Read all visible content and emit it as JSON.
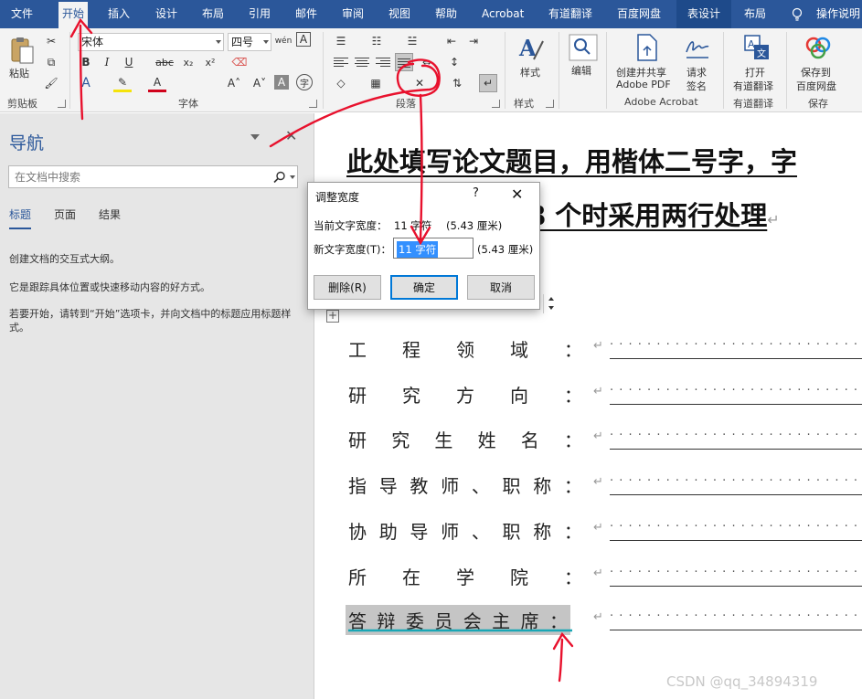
{
  "tabs": [
    "文件",
    "开始",
    "插入",
    "设计",
    "布局",
    "引用",
    "邮件",
    "审阅",
    "视图",
    "帮助",
    "Acrobat",
    "有道翻译",
    "百度网盘",
    "表设计",
    "布局"
  ],
  "tell_me": "操作说明",
  "ribbon": {
    "clipboard": {
      "paste": "粘贴",
      "group": "剪贴板"
    },
    "font": {
      "font_name": "宋体",
      "font_size": "四号",
      "group": "字体"
    },
    "paragraph": {
      "group": "段落"
    },
    "styles": {
      "label": "样式",
      "group": "样式"
    },
    "editing": {
      "label": "编辑"
    },
    "acrobat": {
      "create_share_1": "创建并共享",
      "create_share_2": "Adobe PDF",
      "sign_1": "请求",
      "sign_2": "签名",
      "group": "Adobe Acrobat"
    },
    "youdao": {
      "open_1": "打开",
      "open_2": "有道翻译",
      "group": "有道翻译"
    },
    "baidu": {
      "save_1": "保存到",
      "save_2": "百度网盘",
      "group": "保存"
    }
  },
  "nav": {
    "title": "导航",
    "search_placeholder": "在文档中搜索",
    "tabs": [
      "标题",
      "页面",
      "结果"
    ],
    "p1": "创建文档的交互式大纲。",
    "p2": "它是跟踪具体位置或快速移动内容的好方式。",
    "p3": "若要开始，请转到“开始”选项卡，并向文档中的标题应用标题样式。"
  },
  "doc": {
    "title_line1": "此处填写论文题目，用楷体二号字，字",
    "title_line2": "8 个时采用两行处理",
    "rows": [
      {
        "label": "工程领域：",
        "chars": [
          "工",
          "程",
          "领",
          "域",
          "："
        ]
      },
      {
        "label": "研究方向：",
        "chars": [
          "研",
          "究",
          "方",
          "向",
          "："
        ]
      },
      {
        "label": "研究生姓名：",
        "chars": [
          "研",
          "究",
          "生",
          "姓",
          "名",
          "："
        ]
      },
      {
        "label": "指导教师、职称：",
        "chars": [
          "指",
          "导",
          "教",
          "师",
          "、",
          "职",
          "称",
          "："
        ]
      },
      {
        "label": "协助导师、职称：",
        "chars": [
          "协",
          "助",
          "导",
          "师",
          "、",
          "职",
          "称",
          "："
        ]
      },
      {
        "label": "所在学院：",
        "chars": [
          "所",
          "在",
          "学",
          "院",
          "："
        ]
      },
      {
        "label": "答辩委员会主席：",
        "chars": [
          "答",
          "辩",
          "委",
          "员",
          "会",
          "主",
          "席",
          "："
        ]
      }
    ]
  },
  "dialog": {
    "title": "调整宽度",
    "help": "?",
    "current_label": "当前文字宽度：",
    "current_value": "11 字符",
    "current_cm": "(5.43 厘米)",
    "new_label": "新文字宽度(T)：",
    "new_value": "11 字符",
    "new_cm": "(5.43 厘米)",
    "delete": "删除(R)",
    "ok": "确定",
    "cancel": "取消"
  },
  "watermark": "CSDN @qq_34894319",
  "colors": {
    "title_bar": "#2b579a",
    "annotation": "#e8112d",
    "row_highlight": "#c5c5c5",
    "selection": "#3390ff"
  }
}
